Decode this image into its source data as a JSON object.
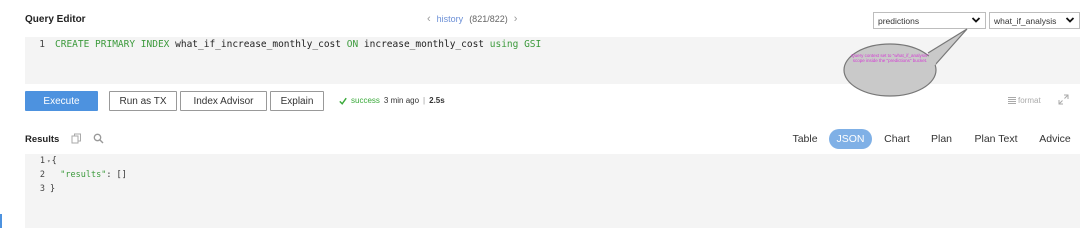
{
  "header": {
    "title": "Query Editor",
    "history_label": "history",
    "history_count": "(821/822)"
  },
  "context": {
    "bucket": "predictions",
    "scope": "what_if_analysis"
  },
  "editor": {
    "line_number": "1",
    "tokens": {
      "k1": "CREATE PRIMARY INDEX",
      "id1": "what_if_increase_monthly_cost",
      "k2": "ON",
      "id2": "increase_monthly_cost",
      "k3": "using GSI"
    }
  },
  "callout": {
    "text": "Query context set to \"what_if_analysis\" scope inside the \"predictions\" bucket."
  },
  "toolbar": {
    "execute": "Execute",
    "run_as_tx": "Run as TX",
    "index_advisor": "Index Advisor",
    "explain": "Explain",
    "status": "success",
    "time_ago": "3 min ago",
    "separator": "|",
    "duration": "2.5s",
    "format": "format"
  },
  "results": {
    "label": "Results",
    "tabs": [
      "Table",
      "JSON",
      "Chart",
      "Plan",
      "Plan Text",
      "Advice"
    ],
    "active_tab": "JSON",
    "lines": [
      {
        "n": "1",
        "text": "{"
      },
      {
        "n": "2",
        "key": "\"results\"",
        "rest": ": []"
      },
      {
        "n": "3",
        "text": "}"
      }
    ]
  },
  "colors": {
    "accent": "#4d92df",
    "active_tab": "#7fb0e6",
    "keyword": "#3c9a3c",
    "callout_text": "#d43ad4"
  }
}
